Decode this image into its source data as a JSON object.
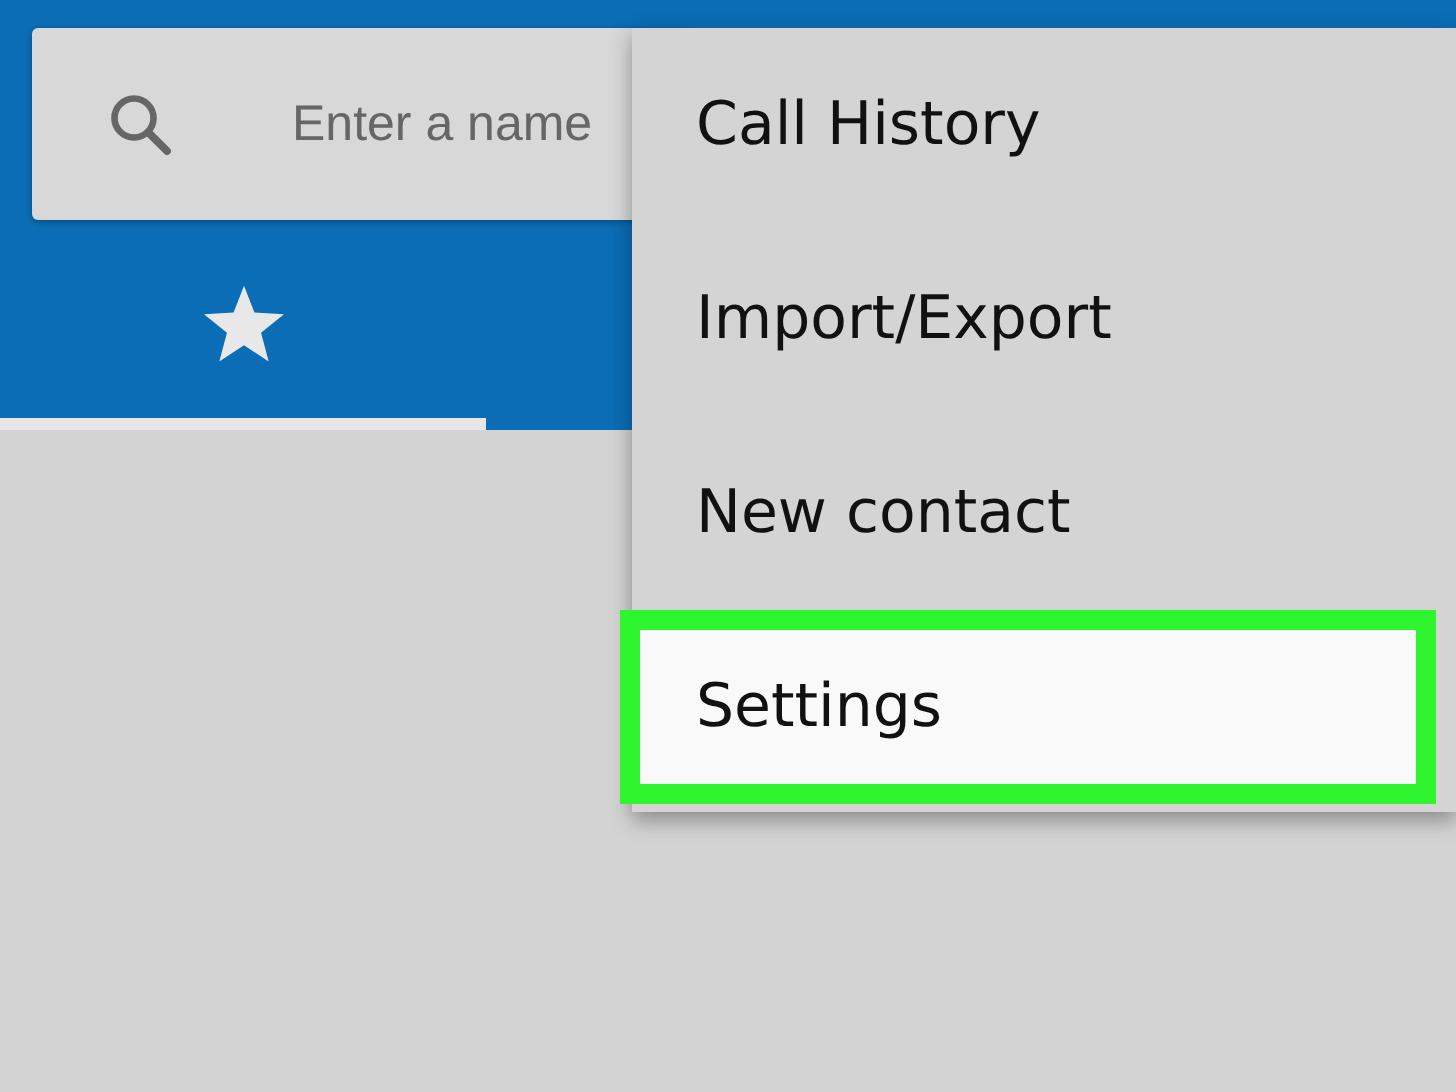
{
  "search": {
    "placeholder": "Enter a name"
  },
  "tabs": [
    {
      "kind": "star",
      "selected": true
    }
  ],
  "menu": {
    "items": [
      {
        "label": "Call History",
        "highlighted": false
      },
      {
        "label": "Import/Export",
        "highlighted": false
      },
      {
        "label": "New contact",
        "highlighted": false
      },
      {
        "label": "Settings",
        "highlighted": true
      }
    ]
  }
}
